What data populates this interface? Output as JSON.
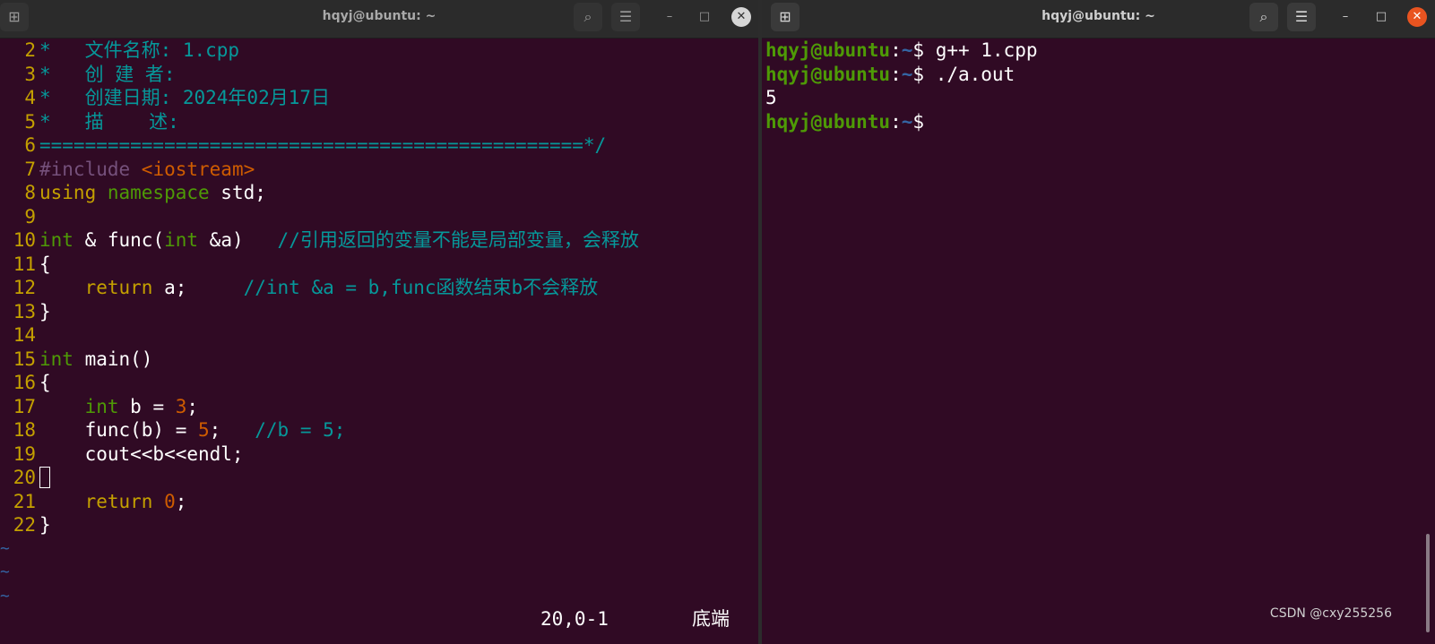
{
  "left_window": {
    "title": "hqyj@ubuntu: ~",
    "new_tab_icon": "⊞",
    "search_icon": "⌕",
    "menu_icon": "☰",
    "minimize": "–",
    "maximize": "□",
    "close": "✕",
    "editor": {
      "lines": [
        {
          "num": "2",
          "parts": [
            {
              "t": "*   文件名称: 1.cpp",
              "c": "com"
            }
          ]
        },
        {
          "num": "3",
          "parts": [
            {
              "t": "*   创 建 者:",
              "c": "com"
            }
          ]
        },
        {
          "num": "4",
          "parts": [
            {
              "t": "*   创建日期: 2024年02月17日",
              "c": "com"
            }
          ]
        },
        {
          "num": "5",
          "parts": [
            {
              "t": "*   描    述:",
              "c": "com"
            }
          ]
        },
        {
          "num": "6",
          "parts": [
            {
              "t": "================================================*/",
              "c": "com"
            }
          ]
        },
        {
          "num": "7",
          "parts": [
            {
              "t": "#include ",
              "c": "pre"
            },
            {
              "t": "<iostream>",
              "c": "str"
            }
          ]
        },
        {
          "num": "8",
          "parts": [
            {
              "t": "using ",
              "c": "kw"
            },
            {
              "t": "namespace",
              "c": "type"
            },
            {
              "t": " std;",
              "c": "txt"
            }
          ]
        },
        {
          "num": "9",
          "parts": []
        },
        {
          "num": "10",
          "parts": [
            {
              "t": "int",
              "c": "type"
            },
            {
              "t": " & func(",
              "c": "txt"
            },
            {
              "t": "int",
              "c": "type"
            },
            {
              "t": " &a)   ",
              "c": "txt"
            },
            {
              "t": "//引用返回的变量不能是局部变量，会释放",
              "c": "com"
            }
          ]
        },
        {
          "num": "11",
          "parts": [
            {
              "t": "{",
              "c": "txt"
            }
          ]
        },
        {
          "num": "12",
          "parts": [
            {
              "t": "    ",
              "c": "txt"
            },
            {
              "t": "return",
              "c": "kw"
            },
            {
              "t": " a;     ",
              "c": "txt"
            },
            {
              "t": "//int &a = b,func函数结束b不会释放",
              "c": "com"
            }
          ]
        },
        {
          "num": "13",
          "parts": [
            {
              "t": "}",
              "c": "txt"
            }
          ]
        },
        {
          "num": "14",
          "parts": []
        },
        {
          "num": "15",
          "parts": [
            {
              "t": "int",
              "c": "type"
            },
            {
              "t": " main()",
              "c": "txt"
            }
          ]
        },
        {
          "num": "16",
          "parts": [
            {
              "t": "{",
              "c": "txt"
            }
          ]
        },
        {
          "num": "17",
          "parts": [
            {
              "t": "    ",
              "c": "txt"
            },
            {
              "t": "int",
              "c": "type"
            },
            {
              "t": " b = ",
              "c": "txt"
            },
            {
              "t": "3",
              "c": "num"
            },
            {
              "t": ";",
              "c": "txt"
            }
          ]
        },
        {
          "num": "18",
          "parts": [
            {
              "t": "    func(b) = ",
              "c": "txt"
            },
            {
              "t": "5",
              "c": "num"
            },
            {
              "t": ";   ",
              "c": "txt"
            },
            {
              "t": "//b = 5;",
              "c": "com"
            }
          ]
        },
        {
          "num": "19",
          "parts": [
            {
              "t": "    cout<<b<<endl;",
              "c": "txt"
            }
          ]
        },
        {
          "num": "20",
          "parts": [],
          "cursor": true
        },
        {
          "num": "21",
          "parts": [
            {
              "t": "    ",
              "c": "txt"
            },
            {
              "t": "return",
              "c": "kw"
            },
            {
              "t": " ",
              "c": "txt"
            },
            {
              "t": "0",
              "c": "num"
            },
            {
              "t": ";",
              "c": "txt"
            }
          ]
        },
        {
          "num": "22",
          "parts": [
            {
              "t": "}",
              "c": "txt"
            }
          ]
        }
      ],
      "tilde_lines": [
        "~",
        "~",
        "~"
      ],
      "status_position": "20,0-1",
      "status_scroll": "底端"
    }
  },
  "right_window": {
    "title": "hqyj@ubuntu: ~",
    "new_tab_icon": "⊞",
    "search_icon": "⌕",
    "menu_icon": "☰",
    "minimize": "–",
    "maximize": "□",
    "close": "✕",
    "terminal": {
      "lines": [
        {
          "user": "hqyj@ubuntu",
          "sep": ":",
          "path": "~",
          "sym": "$ ",
          "cmd": "g++ 1.cpp"
        },
        {
          "user": "hqyj@ubuntu",
          "sep": ":",
          "path": "~",
          "sym": "$ ",
          "cmd": "./a.out"
        },
        {
          "output": "5"
        },
        {
          "user": "hqyj@ubuntu",
          "sep": ":",
          "path": "~",
          "sym": "$",
          "cmd": ""
        }
      ]
    },
    "watermark": "CSDN @cxy255256"
  }
}
